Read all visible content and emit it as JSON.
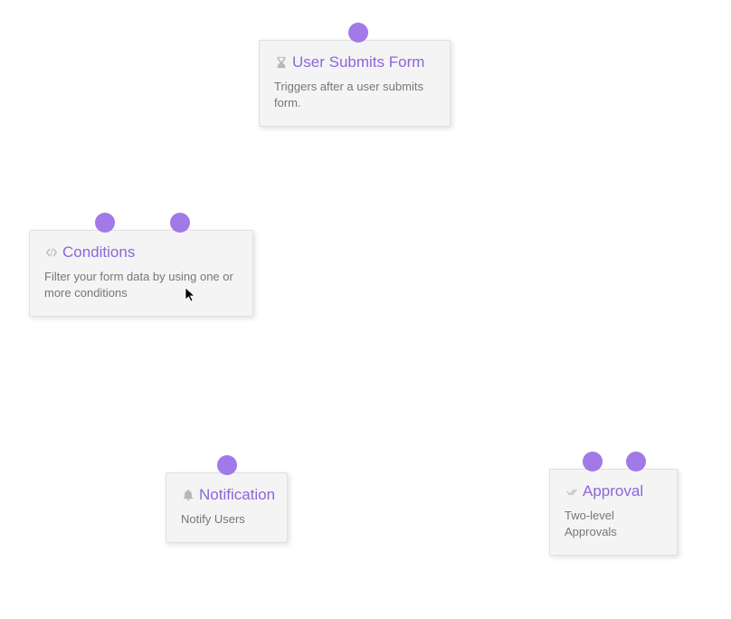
{
  "colors": {
    "accent": "#8c66db",
    "port": "#a179e8",
    "node_bg": "#f4f4f4",
    "text_muted": "#777777",
    "icon": "#b8b8b8"
  },
  "nodes": {
    "trigger": {
      "title": "User Submits Form",
      "description": "Triggers after a user submits form.",
      "icon": "hourglass-icon"
    },
    "conditions": {
      "title": "Conditions",
      "description": "Filter your form data by using one or more conditions",
      "icon": "code-icon"
    },
    "notification": {
      "title": "Notification",
      "description": "Notify Users",
      "icon": "bell-icon"
    },
    "approval": {
      "title": "Approval",
      "description": "Two-level Approvals",
      "icon": "check-icon"
    }
  }
}
